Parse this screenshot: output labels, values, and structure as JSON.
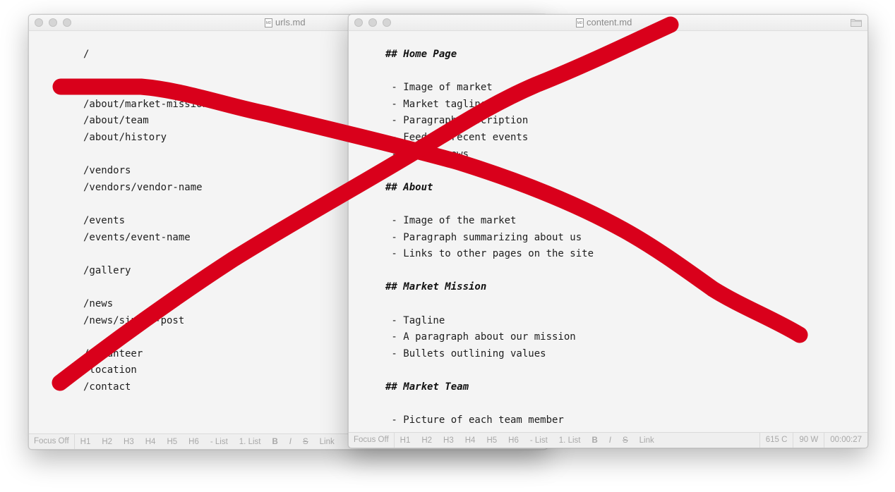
{
  "windows": {
    "urls": {
      "title": "urls.md",
      "icon_label": "MD",
      "lines": [
        "/",
        "",
        "/about",
        "/about/market-mission",
        "/about/team",
        "/about/history",
        "",
        "/vendors",
        "/vendors/vendor-name",
        "",
        "/events",
        "/events/event-name",
        "",
        "/gallery",
        "",
        "/news",
        "/news/single-post",
        "",
        "/volunteer",
        "/location",
        "/contact"
      ]
    },
    "content": {
      "title": "content.md",
      "icon_label": "MD",
      "lines": [
        {
          "text": "## Home Page",
          "heading": true
        },
        {
          "text": ""
        },
        {
          "text": " - Image of market"
        },
        {
          "text": " - Market tagline"
        },
        {
          "text": " - Paragraph description"
        },
        {
          "text": " - Feed of recent events"
        },
        {
          "text": " - Recent news"
        },
        {
          "text": ""
        },
        {
          "text": "## About",
          "heading": true
        },
        {
          "text": ""
        },
        {
          "text": " - Image of the market"
        },
        {
          "text": " - Paragraph summarizing about us"
        },
        {
          "text": " - Links to other pages on the site"
        },
        {
          "text": ""
        },
        {
          "text": "## Market Mission",
          "heading": true
        },
        {
          "text": ""
        },
        {
          "text": " - Tagline"
        },
        {
          "text": " - A paragraph about our mission"
        },
        {
          "text": " - Bullets outlining values"
        },
        {
          "text": ""
        },
        {
          "text": "## Market Team",
          "heading": true
        },
        {
          "text": ""
        },
        {
          "text": " - Picture of each team member"
        }
      ]
    }
  },
  "statusbar": {
    "focus": "Focus Off",
    "h1": "H1",
    "h2": "H2",
    "h3": "H3",
    "h4": "H4",
    "h5": "H5",
    "h6": "H6",
    "list": "- List",
    "numbered_list": "1. List",
    "bold": "B",
    "italic": "I",
    "strike": "S",
    "link": "Link",
    "characters": "615 C",
    "words": "90 W",
    "timer": "00:00:27"
  },
  "colors": {
    "cross_stroke": "#d9001b",
    "window_bg": "#f4f4f4"
  },
  "icons": [
    "document-icon",
    "folder-icon",
    "close-light",
    "minimize-light",
    "zoom-light"
  ]
}
